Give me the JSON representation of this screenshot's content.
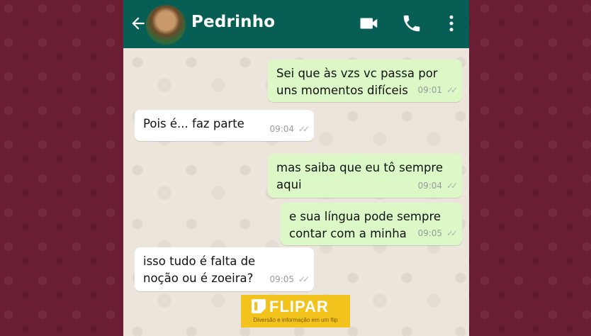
{
  "chat": {
    "contact_name": "Pedrinho"
  },
  "messages": [
    {
      "direction": "out",
      "text_lines": [
        "Sei que às vzs vc passa por",
        "uns momentos difíceis"
      ],
      "time": "09:01"
    },
    {
      "direction": "in",
      "text_lines": [
        "Pois é... faz parte"
      ],
      "time": "09:04"
    },
    {
      "direction": "out",
      "text_lines": [
        "mas saiba que eu tô sempre",
        "aqui"
      ],
      "time": "09:04"
    },
    {
      "direction": "out",
      "text_lines": [
        "e sua língua pode sempre",
        "contar com a minha"
      ],
      "time": "09:05"
    },
    {
      "direction": "in",
      "text_lines": [
        "isso tudo é falta de",
        "noção ou é zoeira?"
      ],
      "time": "09:05"
    }
  ],
  "watermark": {
    "brand": "FLIPAR",
    "tagline": "Diversão e informação em um flip"
  },
  "icons": {
    "back": "arrow-left-icon",
    "video": "video-camera-icon",
    "call": "phone-icon",
    "more": "more-vertical-icon",
    "ticks": "double-check-icon"
  },
  "colors": {
    "header": "#075e54",
    "outgoing_bubble": "#dcf8c6",
    "incoming_bubble": "#ffffff",
    "chat_background": "#ece5dc",
    "page_background": "#6b1d33",
    "watermark": "#f2c21d"
  }
}
